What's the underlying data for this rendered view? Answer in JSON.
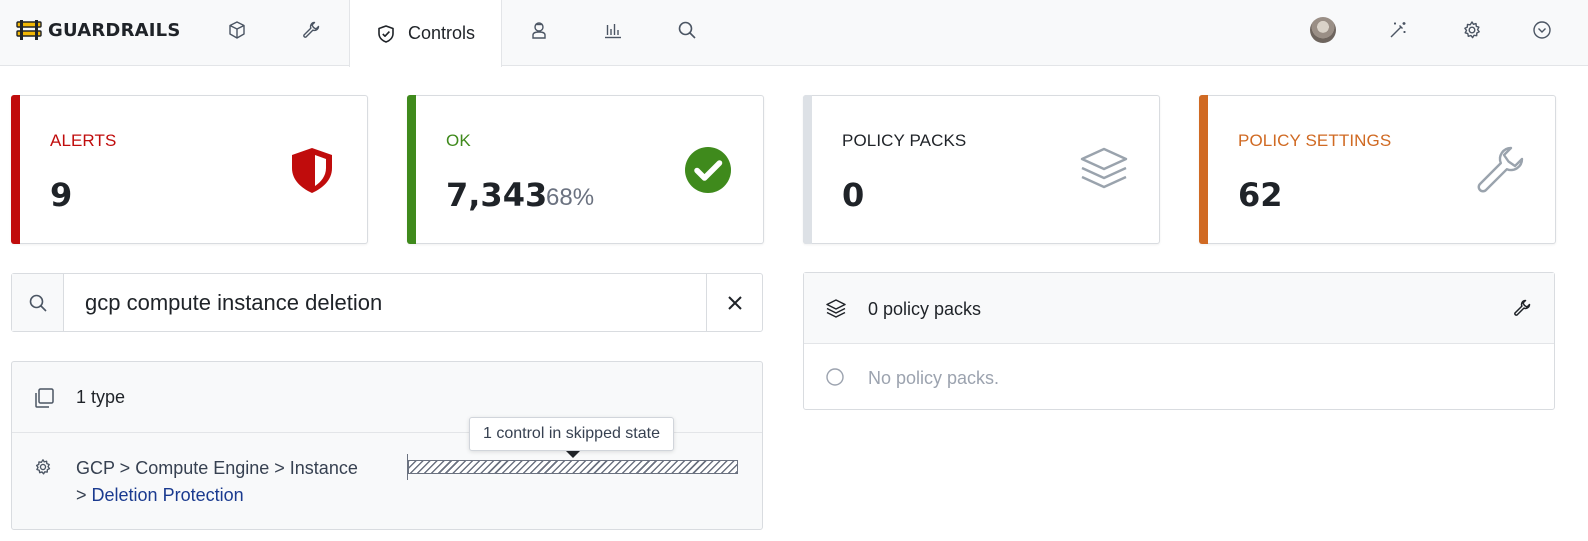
{
  "nav": {
    "brand": "GUARDRAILS",
    "active_tab": "Controls"
  },
  "cards": {
    "alerts": {
      "label": "ALERTS",
      "value": "9",
      "color": "#c00c0c"
    },
    "ok": {
      "label": "OK",
      "value": "7,343",
      "percent": "68%",
      "color": "#3f8a1c"
    },
    "policy_packs": {
      "label": "POLICY PACKS",
      "value": "0",
      "color": "#dde1e6"
    },
    "policy_settings": {
      "label": "POLICY SETTINGS",
      "value": "62",
      "color": "#d06a23"
    }
  },
  "search": {
    "value": "gcp compute instance deletion"
  },
  "types": {
    "summary": "1 type",
    "row": {
      "path_prefix": "GCP > Compute Engine > Instance",
      "path_sep": ">",
      "path_link": "Deletion Protection"
    },
    "tooltip": "1 control in skipped state"
  },
  "packs": {
    "summary": "0 policy packs",
    "empty": "No policy packs."
  },
  "icons": {
    "nav": [
      "resources-cube-icon",
      "wrench-icon",
      "shield-check-icon",
      "agent-icon",
      "reports-chart-icon",
      "search-icon"
    ],
    "right": [
      "avatar",
      "magic-wand-icon",
      "gear-icon",
      "chevron-down-circle-icon"
    ]
  }
}
